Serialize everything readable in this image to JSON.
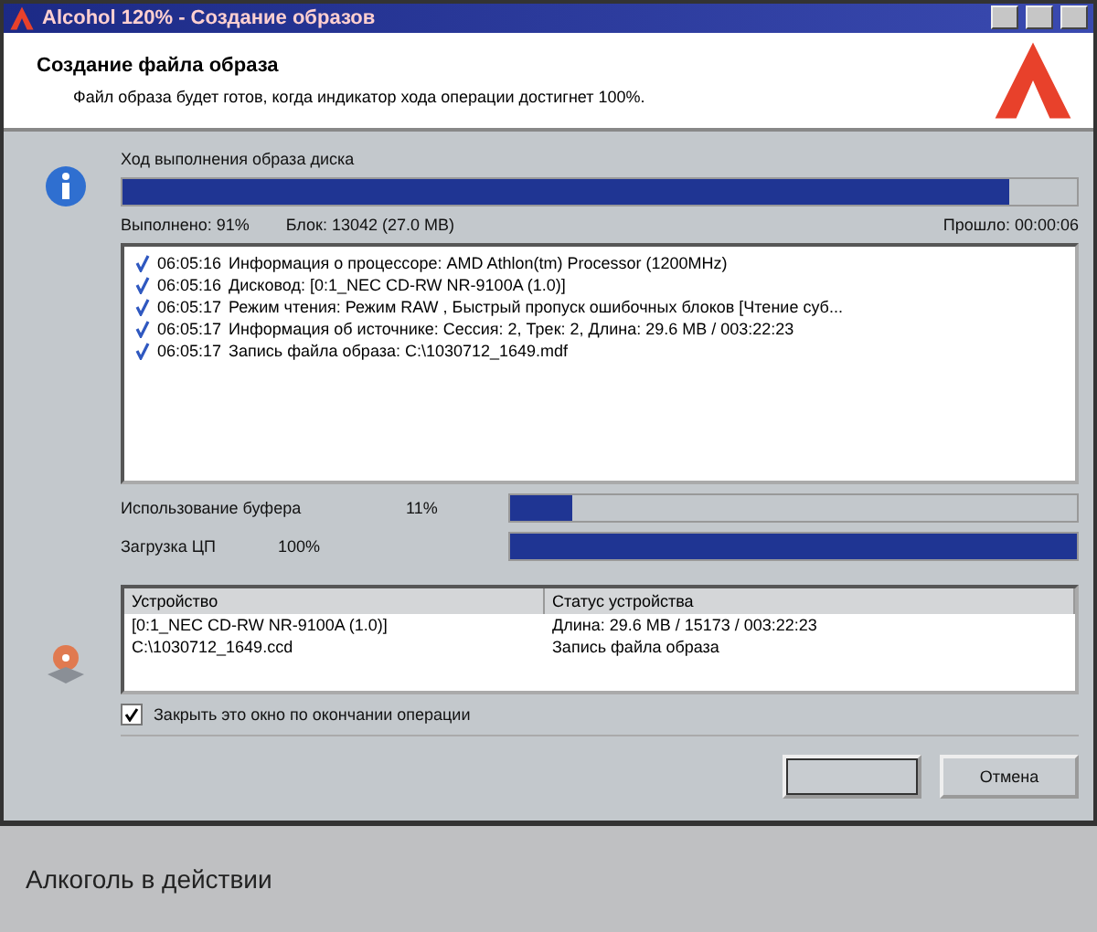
{
  "window": {
    "title": "Alcohol 120% - Создание образов"
  },
  "header": {
    "title": "Создание файла образа",
    "subtitle": "Файл образа будет готов, когда индикатор хода операции достигнет 100%."
  },
  "progress": {
    "label": "Ход выполнения образа диска",
    "level": 0.93,
    "done": "Выполнено:  91%",
    "block": "Блок:  13042 (27.0 MB)",
    "elapsed": "Прошло: 00:00:06"
  },
  "log": [
    {
      "time": "06:05:16",
      "text": "Информация о процессоре: AMD Athlon(tm) Processor (1200MHz)"
    },
    {
      "time": "06:05:16",
      "text": "Дисковод: [0:1_NEC CD-RW NR-9100A (1.0)]"
    },
    {
      "time": "06:05:17",
      "text": "Режим чтения: Режим RAW , Быстрый пропуск ошибочных блоков [Чтение суб..."
    },
    {
      "time": "06:05:17",
      "text": "Информация об источнике: Сессия: 2, Трек: 2, Длина: 29.6 MB / 003:22:23"
    },
    {
      "time": "06:05:17",
      "text": "Запись файла образа: C:\\1030712_1649.mdf"
    }
  ],
  "meters": [
    {
      "label": "Использование буфера",
      "reading": "11%",
      "level": 0.11
    },
    {
      "label": "Загрузка ЦП",
      "reading": "100%",
      "level": 1
    }
  ],
  "devices": {
    "columns": [
      "Устройство",
      "Статус устройства"
    ],
    "rows": [
      [
        "[0:1_NEC CD-RW NR-9100A (1.0)]",
        "Длина: 29.6 MB / 15173 / 003:22:23"
      ],
      [
        "C:\\1030712_1649.ccd",
        "Запись файла образа"
      ]
    ]
  },
  "close_option": {
    "label": "Закрыть это окно по окончании операции",
    "checked": true
  },
  "buttons": [
    {
      "disabled": true
    },
    {
      "label": "Отмена",
      "disabled": false
    }
  ],
  "caption": "Алкоголь в действии"
}
